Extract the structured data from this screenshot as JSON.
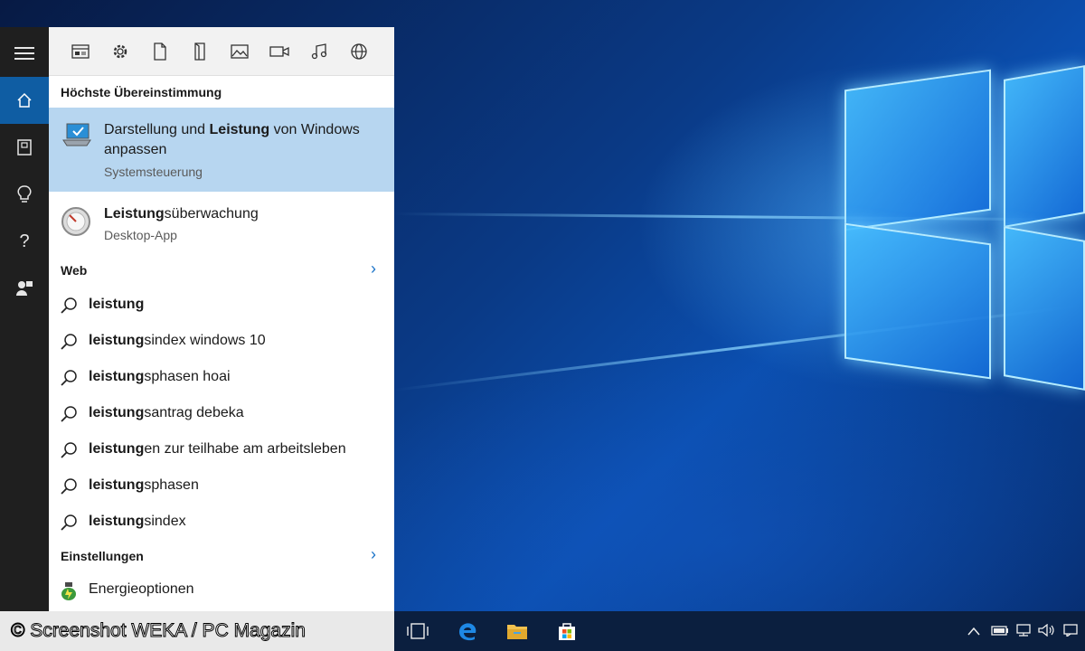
{
  "rail": {
    "items": [
      "menu-icon",
      "home-icon",
      "notebook-icon",
      "lightbulb-icon",
      "help-icon",
      "feedback-icon"
    ]
  },
  "filters": [
    "apps-icon",
    "settings-icon",
    "document-icon",
    "folder-icon",
    "photo-icon",
    "video-icon",
    "music-icon",
    "web-icon"
  ],
  "results": {
    "best_match_header": "Höchste Übereinstimmung",
    "best_match": {
      "title_pre": "Darstellung und ",
      "title_bold": "Leistung",
      "title_post": " von Windows",
      "title_line2": "anpassen",
      "subtitle": "Systemsteuerung"
    },
    "second": {
      "title_bold": "Leistung",
      "title_post": "süberwachung",
      "subtitle": "Desktop-App"
    },
    "web_header": "Web",
    "web_suggestions": [
      {
        "bold": "leistung",
        "rest": ""
      },
      {
        "bold": "leistung",
        "rest": "sindex windows 10"
      },
      {
        "bold": "leistung",
        "rest": "sphasen hoai"
      },
      {
        "bold": "leistung",
        "rest": "santrag debeka"
      },
      {
        "bold": "leistung",
        "rest": "en zur teilhabe am arbeitsleben"
      },
      {
        "bold": "leistung",
        "rest": "sphasen"
      },
      {
        "bold": "leistung",
        "rest": "sindex"
      }
    ],
    "settings_header": "Einstellungen",
    "settings_item": "Energieoptionen"
  },
  "watermark": "© Screenshot WEKA / PC Magazin",
  "colors": {
    "accent": "#0f5da3",
    "selected": "#b7d6f0",
    "chevron": "#1a73c8"
  }
}
